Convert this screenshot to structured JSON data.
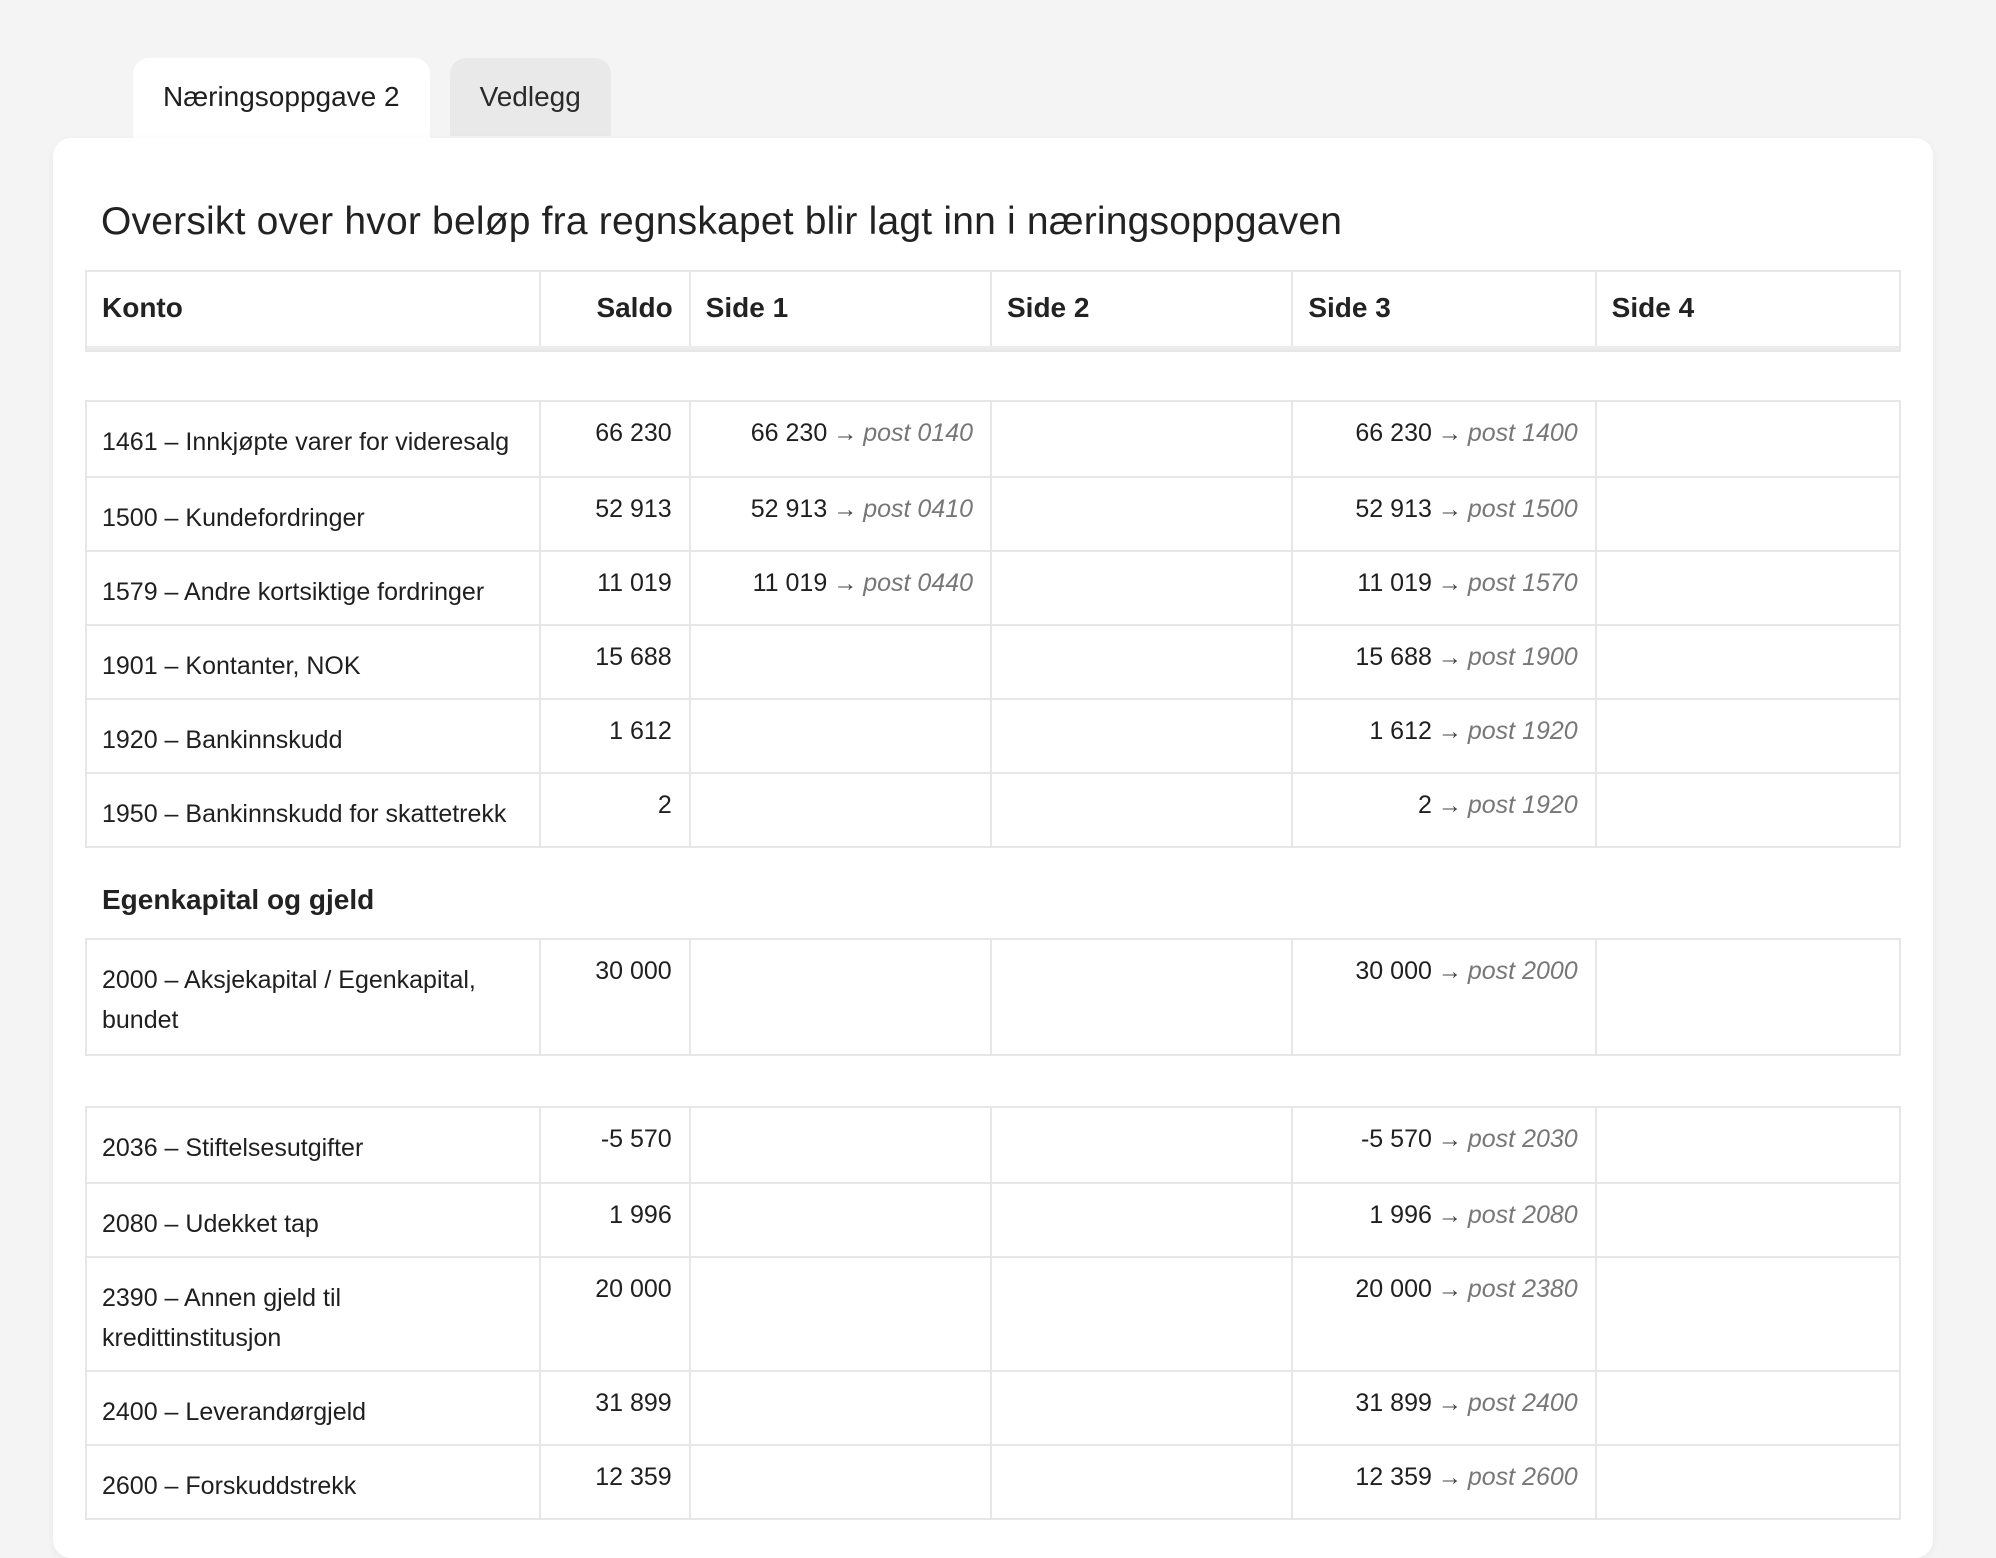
{
  "tabs": [
    {
      "label": "Næringsoppgave 2",
      "active": true
    },
    {
      "label": "Vedlegg",
      "active": false
    }
  ],
  "title": "Oversikt over hvor beløp fra regnskapet blir lagt inn i næringsoppgaven",
  "columns": [
    "Konto",
    "Saldo",
    "Side 1",
    "Side 2",
    "Side 3",
    "Side 4"
  ],
  "arrow_glyph": "→",
  "group1": [
    {
      "konto": "1461 – Innkjøpte varer for videresalg",
      "saldo": "66 230",
      "s1v": "66 230",
      "s1p": "post 0140",
      "s3v": "66 230",
      "s3p": "post 1400"
    },
    {
      "konto": "1500 – Kundefordringer",
      "saldo": "52 913",
      "s1v": "52 913",
      "s1p": "post 0410",
      "s3v": "52 913",
      "s3p": "post 1500"
    },
    {
      "konto": "1579 – Andre kortsiktige fordringer",
      "saldo": "11 019",
      "s1v": "11 019",
      "s1p": "post 0440",
      "s3v": "11 019",
      "s3p": "post 1570"
    },
    {
      "konto": "1901 – Kontanter, NOK",
      "saldo": "15 688",
      "s3v": "15 688",
      "s3p": "post 1900"
    },
    {
      "konto": "1920 – Bankinnskudd",
      "saldo": "1 612",
      "s3v": "1 612",
      "s3p": "post 1920"
    },
    {
      "konto": "1950 – Bankinnskudd for skattetrekk",
      "saldo": "2",
      "s3v": "2",
      "s3p": "post 1920"
    }
  ],
  "section_label": "Egenkapital og gjeld",
  "group2": [
    {
      "konto": "2000 – Aksjekapital / Egenkapital, bundet",
      "saldo": "30 000",
      "s3v": "30 000",
      "s3p": "post 2000"
    }
  ],
  "group3": [
    {
      "konto": "2036 – Stiftelsesutgifter",
      "saldo": "-5 570",
      "s3v": "-5 570",
      "s3p": "post 2030"
    },
    {
      "konto": "2080 – Udekket tap",
      "saldo": "1 996",
      "s3v": "1 996",
      "s3p": "post 2080"
    },
    {
      "konto": "2390 – Annen gjeld til kredittinstitusjon",
      "saldo": "20 000",
      "s3v": "20 000",
      "s3p": "post 2380"
    },
    {
      "konto": "2400 – Leverandørgjeld",
      "saldo": "31 899",
      "s3v": "31 899",
      "s3p": "post 2400"
    },
    {
      "konto": "2600 – Forskuddstrekk",
      "saldo": "12 359",
      "s3v": "12 359",
      "s3p": "post 2600"
    }
  ]
}
